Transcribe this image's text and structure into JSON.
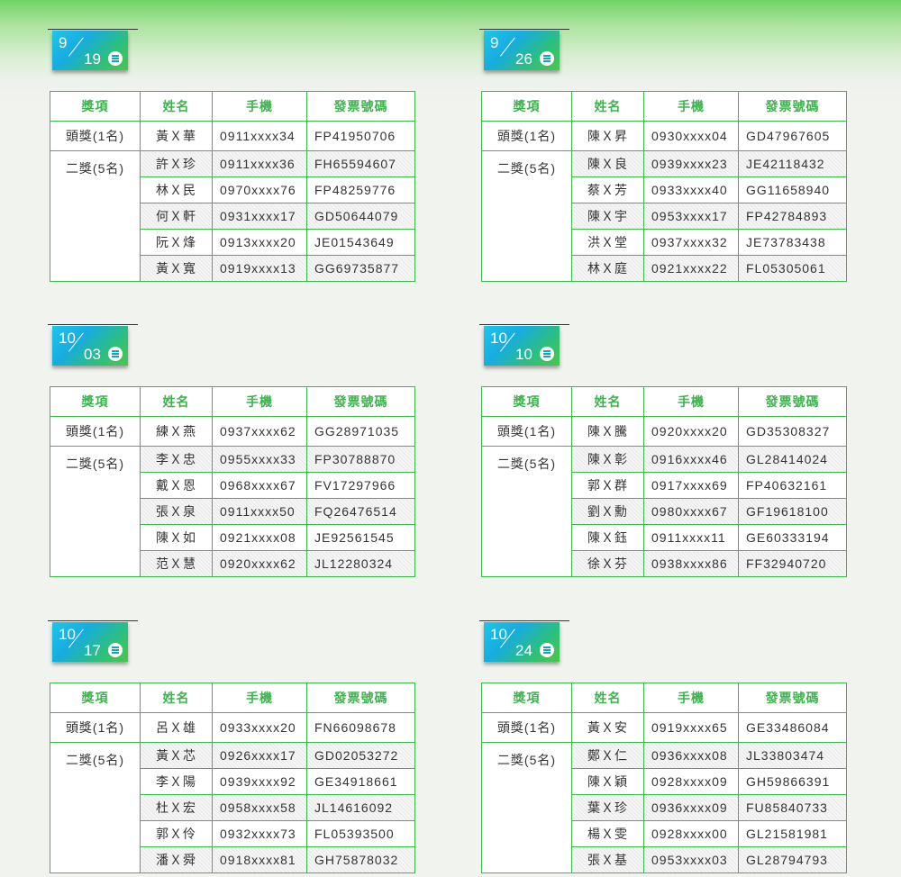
{
  "headers": [
    "獎項",
    "姓名",
    "手機",
    "發票號碼"
  ],
  "draws": [
    {
      "month": "9",
      "day": "19",
      "dow": "三",
      "first": {
        "award": "頭獎(1名)",
        "name": "黃Ｘ華",
        "phone": "0911xxxx34",
        "invoice": "FP41950706"
      },
      "second_award": "二獎(5名)",
      "seconds": [
        {
          "name": "許Ｘ珍",
          "phone": "0911xxxx36",
          "invoice": "FH65594607"
        },
        {
          "name": "林Ｘ民",
          "phone": "0970xxxx76",
          "invoice": "FP48259776"
        },
        {
          "name": "何Ｘ軒",
          "phone": "0931xxxx17",
          "invoice": "GD50644079"
        },
        {
          "name": "阮Ｘ烽",
          "phone": "0913xxxx20",
          "invoice": "JE01543649"
        },
        {
          "name": "黃Ｘ寬",
          "phone": "0919xxxx13",
          "invoice": "GG69735877"
        }
      ]
    },
    {
      "month": "9",
      "day": "26",
      "dow": "三",
      "first": {
        "award": "頭獎(1名)",
        "name": "陳Ｘ昇",
        "phone": "0930xxxx04",
        "invoice": "GD47967605"
      },
      "second_award": "二獎(5名)",
      "seconds": [
        {
          "name": "陳Ｘ良",
          "phone": "0939xxxx23",
          "invoice": "JE42118432"
        },
        {
          "name": "蔡Ｘ芳",
          "phone": "0933xxxx40",
          "invoice": "GG11658940"
        },
        {
          "name": "陳Ｘ宇",
          "phone": "0953xxxx17",
          "invoice": "FP42784893"
        },
        {
          "name": "洪Ｘ堂",
          "phone": "0937xxxx32",
          "invoice": "JE73783438"
        },
        {
          "name": "林Ｘ庭",
          "phone": "0921xxxx22",
          "invoice": "FL05305061"
        }
      ]
    },
    {
      "month": "10",
      "day": "03",
      "dow": "三",
      "first": {
        "award": "頭獎(1名)",
        "name": "練Ｘ燕",
        "phone": "0937xxxx62",
        "invoice": "GG28971035"
      },
      "second_award": "二獎(5名)",
      "seconds": [
        {
          "name": "李Ｘ忠",
          "phone": "0955xxxx33",
          "invoice": "FP30788870"
        },
        {
          "name": "戴Ｘ恩",
          "phone": "0968xxxx67",
          "invoice": "FV17297966"
        },
        {
          "name": "張Ｘ泉",
          "phone": "0911xxxx50",
          "invoice": "FQ26476514"
        },
        {
          "name": "陳Ｘ如",
          "phone": "0921xxxx08",
          "invoice": "JE92561545"
        },
        {
          "name": "范Ｘ慧",
          "phone": "0920xxxx62",
          "invoice": "JL12280324"
        }
      ]
    },
    {
      "month": "10",
      "day": "10",
      "dow": "三",
      "first": {
        "award": "頭獎(1名)",
        "name": "陳Ｘ騰",
        "phone": "0920xxxx20",
        "invoice": "GD35308327"
      },
      "second_award": "二獎(5名)",
      "seconds": [
        {
          "name": "陳Ｘ彰",
          "phone": "0916xxxx46",
          "invoice": "GL28414024"
        },
        {
          "name": "郭Ｘ群",
          "phone": "0917xxxx69",
          "invoice": "FP40632161"
        },
        {
          "name": "劉Ｘ勳",
          "phone": "0980xxxx67",
          "invoice": "GF19618100"
        },
        {
          "name": "陳Ｘ鈺",
          "phone": "0911xxxx11",
          "invoice": "GE60333194"
        },
        {
          "name": "徐Ｘ芬",
          "phone": "0938xxxx86",
          "invoice": "FF32940720"
        }
      ]
    },
    {
      "month": "10",
      "day": "17",
      "dow": "三",
      "first": {
        "award": "頭獎(1名)",
        "name": "呂Ｘ雄",
        "phone": "0933xxxx20",
        "invoice": "FN66098678"
      },
      "second_award": "二獎(5名)",
      "seconds": [
        {
          "name": "黃Ｘ芯",
          "phone": "0926xxxx17",
          "invoice": "GD02053272"
        },
        {
          "name": "李Ｘ陽",
          "phone": "0939xxxx92",
          "invoice": "GE34918661"
        },
        {
          "name": "杜Ｘ宏",
          "phone": "0958xxxx58",
          "invoice": "JL14616092"
        },
        {
          "name": "郭Ｘ伶",
          "phone": "0932xxxx73",
          "invoice": "FL05393500"
        },
        {
          "name": "潘Ｘ舜",
          "phone": "0918xxxx81",
          "invoice": "GH75878032"
        }
      ]
    },
    {
      "month": "10",
      "day": "24",
      "dow": "三",
      "first": {
        "award": "頭獎(1名)",
        "name": "黃Ｘ安",
        "phone": "0919xxxx65",
        "invoice": "GE33486084"
      },
      "second_award": "二獎(5名)",
      "seconds": [
        {
          "name": "鄭Ｘ仁",
          "phone": "0936xxxx08",
          "invoice": "JL33803474"
        },
        {
          "name": "陳Ｘ穎",
          "phone": "0928xxxx09",
          "invoice": "GH59866391"
        },
        {
          "name": "葉Ｘ珍",
          "phone": "0936xxxx09",
          "invoice": "FU85840733"
        },
        {
          "name": "楊Ｘ雯",
          "phone": "0928xxxx00",
          "invoice": "GL21581981"
        },
        {
          "name": "張Ｘ基",
          "phone": "0953xxxx03",
          "invoice": "GL28794793"
        }
      ]
    }
  ]
}
